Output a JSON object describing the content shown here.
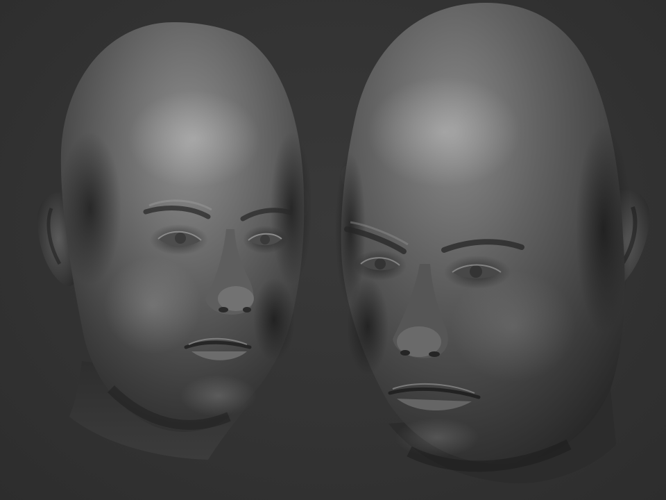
{
  "scene": {
    "background_color": "#333333",
    "material": "clay-grey-matcap",
    "objects": [
      {
        "name": "head-sculpt-left",
        "view": "three-quarter-front",
        "facing": "right"
      },
      {
        "name": "head-sculpt-right",
        "view": "three-quarter-front-low-angle",
        "facing": "left"
      }
    ]
  }
}
